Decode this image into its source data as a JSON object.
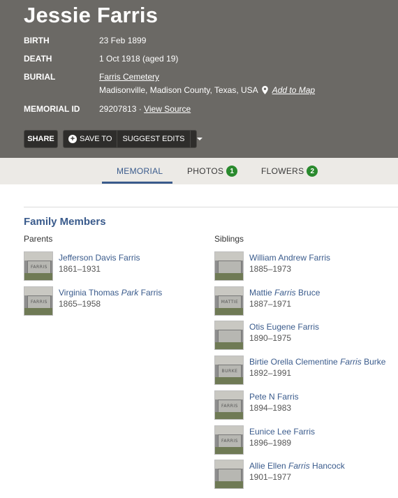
{
  "header": {
    "name": "Jessie Farris",
    "birth_label": "BIRTH",
    "birth_value": "23 Feb 1899",
    "death_label": "DEATH",
    "death_value": "1 Oct 1918 (aged 19)",
    "burial_label": "BURIAL",
    "burial_cemetery": "Farris Cemetery",
    "burial_location": "Madisonville, Madison County, Texas, USA",
    "add_to_map": "Add to Map",
    "memorial_id_label": "MEMORIAL ID",
    "memorial_id_value": "29207813 ·",
    "view_source": "View Source"
  },
  "actions": {
    "share": "SHARE",
    "save_to": "SAVE TO",
    "suggest_edits": "SUGGEST EDITS"
  },
  "tabs": [
    {
      "label": "MEMORIAL",
      "badge": ""
    },
    {
      "label": "PHOTOS",
      "badge": "1"
    },
    {
      "label": "FLOWERS",
      "badge": "2"
    }
  ],
  "family": {
    "title": "Family Members",
    "parents_heading": "Parents",
    "siblings_heading": "Siblings",
    "parents": [
      {
        "name_pre": "Jefferson Davis Farris",
        "name_italic": "",
        "name_post": "",
        "dates": "1861–1931",
        "stone_text": "FARRIS"
      },
      {
        "name_pre": "Virginia Thomas ",
        "name_italic": "Park",
        "name_post": " Farris",
        "dates": "1865–1958",
        "stone_text": "FARRIS"
      }
    ],
    "siblings": [
      {
        "name_pre": "William Andrew Farris",
        "name_italic": "",
        "name_post": "",
        "dates": "1885–1973",
        "stone_text": ""
      },
      {
        "name_pre": "Mattie ",
        "name_italic": "Farris",
        "name_post": " Bruce",
        "dates": "1887–1971",
        "stone_text": "MATTIE"
      },
      {
        "name_pre": "Otis Eugene Farris",
        "name_italic": "",
        "name_post": "",
        "dates": "1890–1975",
        "stone_text": ""
      },
      {
        "name_pre": "Birtie Orella Clementine ",
        "name_italic": "Farris",
        "name_post": " Burke",
        "dates": "1892–1991",
        "stone_text": "BURKE"
      },
      {
        "name_pre": "Pete N Farris",
        "name_italic": "",
        "name_post": "",
        "dates": "1894–1983",
        "stone_text": "FARRIS"
      },
      {
        "name_pre": "Eunice Lee Farris",
        "name_italic": "",
        "name_post": "",
        "dates": "1896–1989",
        "stone_text": "FARRIS"
      },
      {
        "name_pre": "Allie Ellen ",
        "name_italic": "Farris",
        "name_post": " Hancock",
        "dates": "1901–1977",
        "stone_text": ""
      }
    ]
  },
  "colors": {
    "header_bg": "#6b6965",
    "link": "#3a5b8c",
    "badge": "#2a8a2e"
  }
}
